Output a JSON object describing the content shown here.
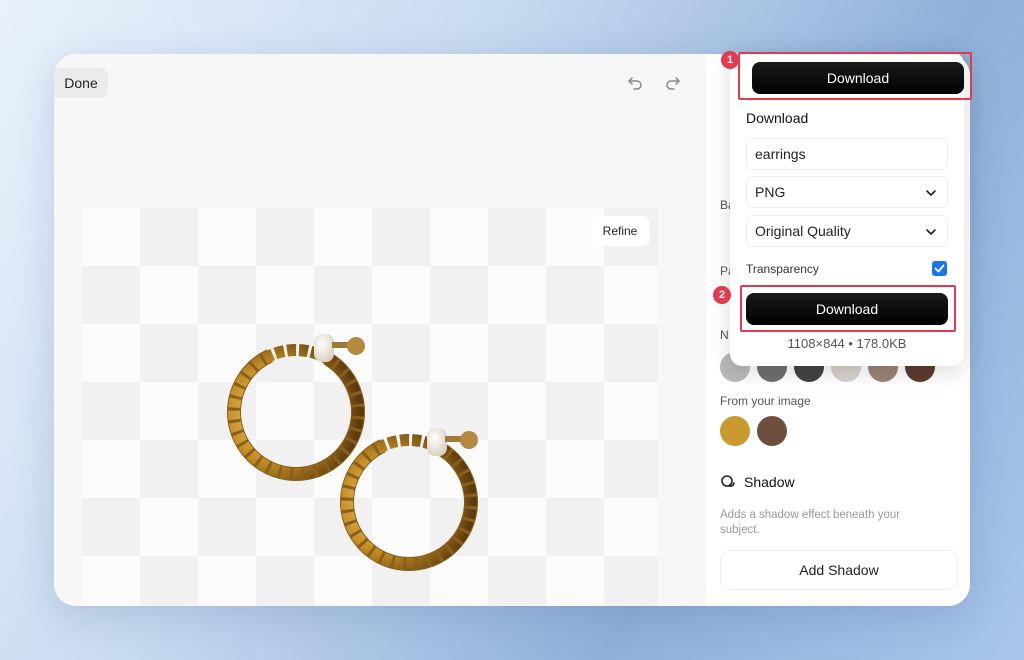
{
  "editor": {
    "done_label": "Done",
    "refine_label": "Refine"
  },
  "sidebar": {
    "partial_labels": [
      "Ba",
      "Pa",
      "N"
    ],
    "neutral_swatches": [
      "#b9b9b9",
      "#707070",
      "#444444",
      "#d8d2cc",
      "#9a8577",
      "#5c3d2f"
    ],
    "from_image_label": "From your image",
    "image_swatches": [
      "#c99a2e",
      "#6e4e3d"
    ],
    "shadow_title": "Shadow",
    "shadow_desc": "Adds a shadow effect beneath your subject.",
    "add_shadow_label": "Add Shadow"
  },
  "download_panel": {
    "top_button_label": "Download",
    "heading": "Download",
    "filename_value": "earrings",
    "format_value": "PNG",
    "quality_value": "Original Quality",
    "transparency_label": "Transparency",
    "transparency_checked": true,
    "download_button_label": "Download",
    "dimensions_text": "1108×844 • 178.0KB"
  },
  "annotations": {
    "step1": "1",
    "step2": "2",
    "highlight_color": "#e53950"
  }
}
